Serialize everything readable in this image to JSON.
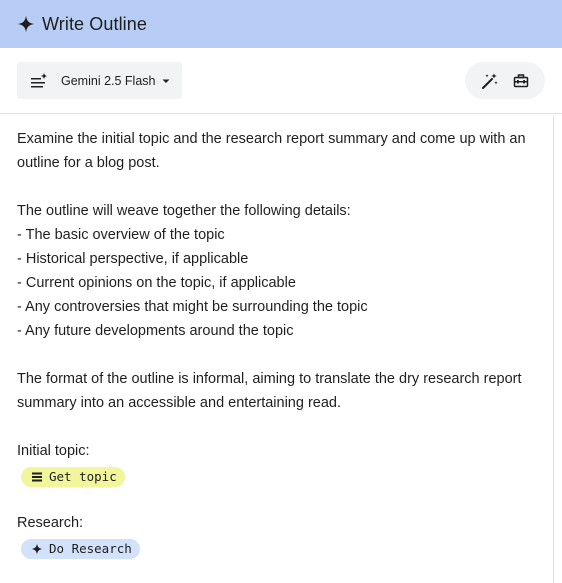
{
  "header": {
    "title": "Write Outline",
    "icon": "sparkle-icon"
  },
  "toolbar": {
    "model": {
      "label": "Gemini 2.5 Flash",
      "icon": "model-settings-icon"
    },
    "tools": [
      "magic-wand-icon",
      "toolbox-icon"
    ]
  },
  "prompt": {
    "intro_line1": "Examine the initial topic and the research report summary and come up with an",
    "intro_line2": "outline for a blog post.",
    "details_heading": "The outline will weave together the following details:",
    "details": [
      "- The basic overview of the topic",
      "- Historical perspective, if applicable",
      "- Current opinions on the topic, if applicable",
      "- Any controversies that might be surrounding the topic",
      "- Any future developments around the topic"
    ],
    "format_line1": "The format of the outline is informal, aiming to translate the dry research report",
    "format_line2": "summary into an accessible and entertaining read.",
    "topic_label": "Initial topic:",
    "topic_chip": "Get topic",
    "research_label": "Research:",
    "research_chip": "Do Research"
  },
  "colors": {
    "header_bg": "#b7cdf5",
    "topic_chip_bg": "#f1f59b",
    "research_chip_bg": "#d3e2fb"
  }
}
